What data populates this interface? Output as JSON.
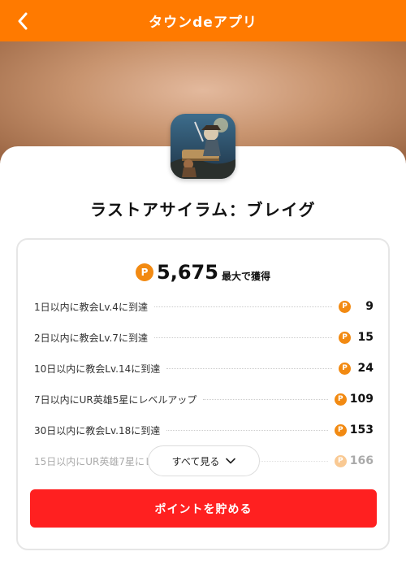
{
  "header": {
    "title": "タウンdeアプリ",
    "back_icon": "chevron-left-icon",
    "background_color": "#ff7a00"
  },
  "app": {
    "name": "ラストアサイラム：ブレイグ"
  },
  "points": {
    "coin_glyph": "P",
    "total": "5,675",
    "suffix": "最大で獲得"
  },
  "missions": [
    {
      "label": "1日以内に教会Lv.4に到達",
      "points": "9"
    },
    {
      "label": "2日以内に教会Lv.7に到達",
      "points": "15"
    },
    {
      "label": "10日以内に教会Lv.14に到達",
      "points": "24"
    },
    {
      "label": "7日以内にUR英雄5星にレベルアップ",
      "points": "109"
    },
    {
      "label": "30日以内に教会Lv.18に到達",
      "points": "153"
    },
    {
      "label": "15日以内にUR英雄7星にレベルアップ",
      "points": "166"
    }
  ],
  "see_all": {
    "label": "すべて見る",
    "icon": "chevron-down-icon"
  },
  "cta": {
    "label": "ポイントを貯める",
    "color": "#ff2020"
  },
  "colors": {
    "coin": "#f28a12",
    "accent": "#ff7a00"
  }
}
